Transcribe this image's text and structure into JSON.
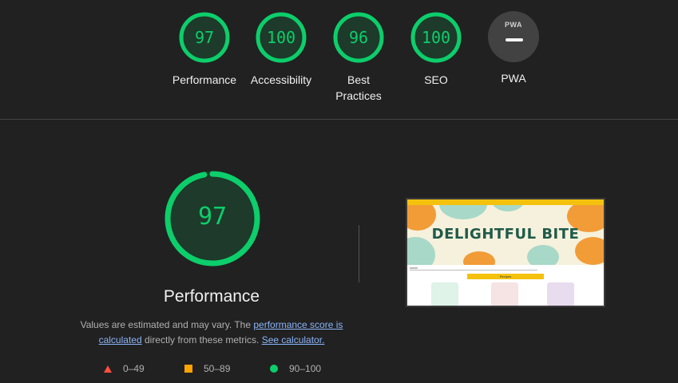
{
  "categories": [
    {
      "score": "97",
      "label": "Performance",
      "value": 97
    },
    {
      "score": "100",
      "label": "Accessibility",
      "value": 100
    },
    {
      "score": "96",
      "label": "Best Practices",
      "value": 96
    },
    {
      "score": "100",
      "label": "SEO",
      "value": 100
    }
  ],
  "pwa": {
    "badge_text": "PWA",
    "label": "PWA"
  },
  "main": {
    "score": "97",
    "value": 97,
    "title": "Performance",
    "desc_1": "Values are estimated and may vary. The ",
    "link_score": "performance score is calculated",
    "desc_2": " directly from these metrics. ",
    "link_calc": "See calculator."
  },
  "legend": {
    "fail": "0–49",
    "average": "50–89",
    "pass": "90–100"
  },
  "screenshot": {
    "hero_title": "DELIGHTFUL BITE",
    "button": "Recipes"
  },
  "colors": {
    "pass": "#0cce6b",
    "average": "#ffa400",
    "fail": "#ff4e42",
    "link": "#8ab4f8"
  }
}
